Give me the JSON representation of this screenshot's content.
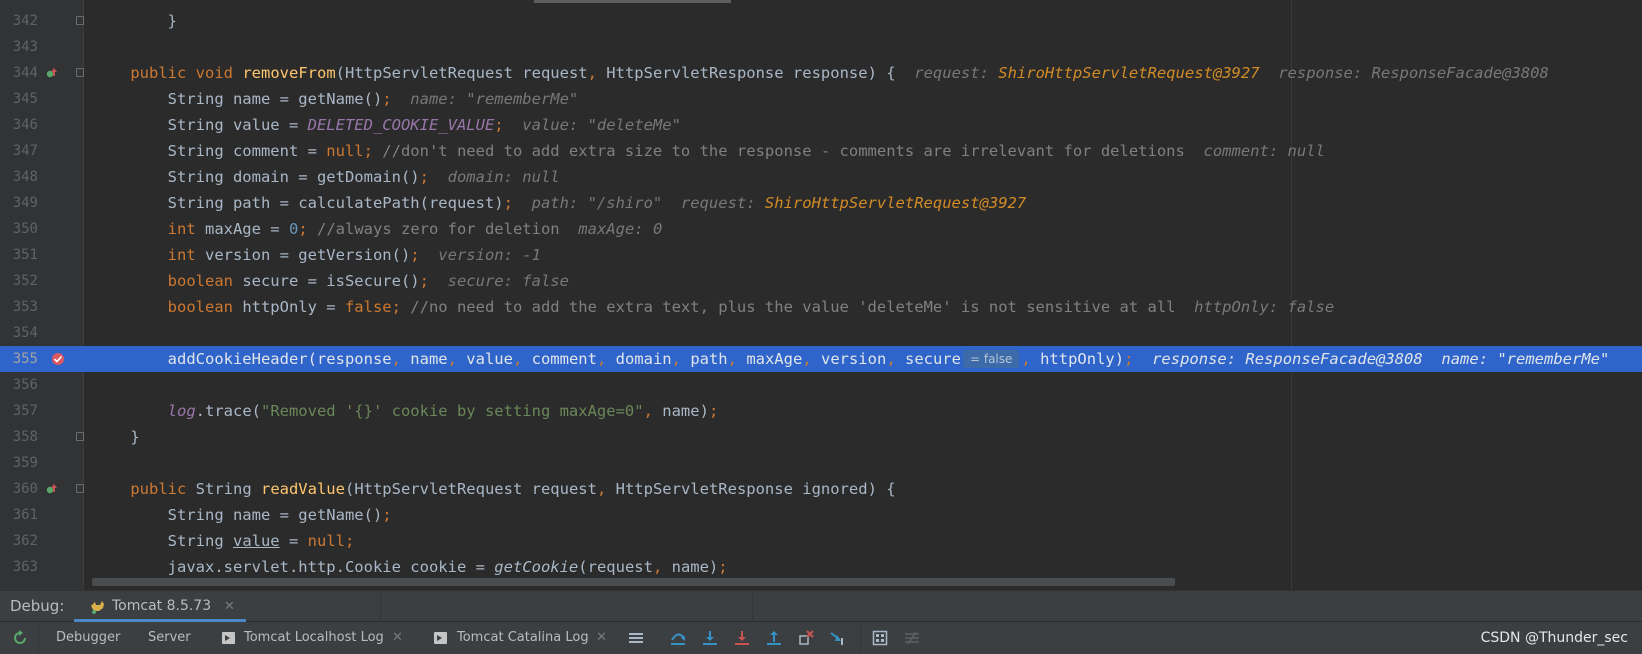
{
  "editor": {
    "lines": [
      {
        "no": "342",
        "gutter": "",
        "fold": true,
        "current": false,
        "tokens": [
          [
            "",
            "        "
          ],
          [
            "",
            "}"
          ]
        ]
      },
      {
        "no": "343",
        "gutter": "",
        "fold": false,
        "current": false,
        "tokens": []
      },
      {
        "no": "344",
        "gutter": "override",
        "fold": true,
        "current": false,
        "tokens": [
          [
            "",
            "    "
          ],
          [
            "k",
            "public "
          ],
          [
            "k",
            "void "
          ],
          [
            "fn",
            "removeFrom"
          ],
          [
            "",
            "(HttpServletRequest request"
          ],
          [
            "k",
            ", "
          ],
          [
            "",
            "HttpServletResponse response) {  "
          ],
          [
            "hint",
            "request: "
          ],
          [
            "hint-obj",
            "ShiroHttpServletRequest@3927"
          ],
          [
            "hint",
            "  response: ResponseFacade@3808"
          ]
        ]
      },
      {
        "no": "345",
        "gutter": "",
        "fold": false,
        "current": false,
        "tokens": [
          [
            "",
            "        String name = getName()"
          ],
          [
            "k",
            ";  "
          ],
          [
            "hint",
            "name: \"rememberMe\""
          ]
        ]
      },
      {
        "no": "346",
        "gutter": "",
        "fold": false,
        "current": false,
        "tokens": [
          [
            "",
            "        String value = "
          ],
          [
            "cst",
            "DELETED_COOKIE_VALUE"
          ],
          [
            "k",
            ";  "
          ],
          [
            "hint",
            "value: \"deleteMe\""
          ]
        ]
      },
      {
        "no": "347",
        "gutter": "",
        "fold": false,
        "current": false,
        "tokens": [
          [
            "",
            "        String comment = "
          ],
          [
            "k",
            "null; "
          ],
          [
            "cm",
            "//don't need to add extra size to the response - comments are irrelevant for deletions  "
          ],
          [
            "hint",
            "comment: null"
          ]
        ]
      },
      {
        "no": "348",
        "gutter": "",
        "fold": false,
        "current": false,
        "tokens": [
          [
            "",
            "        String domain = getDomain()"
          ],
          [
            "k",
            ";  "
          ],
          [
            "hint",
            "domain: null"
          ]
        ]
      },
      {
        "no": "349",
        "gutter": "",
        "fold": false,
        "current": false,
        "tokens": [
          [
            "",
            "        String path = calculatePath(request)"
          ],
          [
            "k",
            ";  "
          ],
          [
            "hint",
            "path: \"/shiro\"  request: "
          ],
          [
            "hint-obj",
            "ShiroHttpServletRequest@3927"
          ]
        ]
      },
      {
        "no": "350",
        "gutter": "",
        "fold": false,
        "current": false,
        "tokens": [
          [
            "",
            "        "
          ],
          [
            "k",
            "int "
          ],
          [
            "",
            "maxAge = "
          ],
          [
            "num",
            "0"
          ],
          [
            "k",
            "; "
          ],
          [
            "cm",
            "//always zero for deletion  "
          ],
          [
            "hint",
            "maxAge: 0"
          ]
        ]
      },
      {
        "no": "351",
        "gutter": "",
        "fold": false,
        "current": false,
        "tokens": [
          [
            "",
            "        "
          ],
          [
            "k",
            "int "
          ],
          [
            "",
            "version = getVersion()"
          ],
          [
            "k",
            ";  "
          ],
          [
            "hint",
            "version: -1"
          ]
        ]
      },
      {
        "no": "352",
        "gutter": "",
        "fold": false,
        "current": false,
        "tokens": [
          [
            "",
            "        "
          ],
          [
            "k",
            "boolean "
          ],
          [
            "",
            "secure = isSecure()"
          ],
          [
            "k",
            ";  "
          ],
          [
            "hint",
            "secure: false"
          ]
        ]
      },
      {
        "no": "353",
        "gutter": "",
        "fold": false,
        "current": false,
        "tokens": [
          [
            "",
            "        "
          ],
          [
            "k",
            "boolean "
          ],
          [
            "",
            "httpOnly = "
          ],
          [
            "k",
            "false; "
          ],
          [
            "cm",
            "//no need to add the extra text, plus the value 'deleteMe' is not sensitive at all  "
          ],
          [
            "hint",
            "httpOnly: false"
          ]
        ]
      },
      {
        "no": "354",
        "gutter": "",
        "fold": false,
        "current": false,
        "tokens": []
      },
      {
        "no": "355",
        "gutter": "breakpoint",
        "fold": false,
        "current": true,
        "tokens": [
          [
            "",
            "        addCookieHeader(response"
          ],
          [
            "k",
            ", "
          ],
          [
            "",
            "name"
          ],
          [
            "k",
            ", "
          ],
          [
            "",
            "value"
          ],
          [
            "k",
            ", "
          ],
          [
            "",
            "comment"
          ],
          [
            "k",
            ", "
          ],
          [
            "",
            "domain"
          ],
          [
            "k",
            ", "
          ],
          [
            "",
            "path"
          ],
          [
            "k",
            ", "
          ],
          [
            "",
            "maxAge"
          ],
          [
            "k",
            ", "
          ],
          [
            "",
            "version"
          ],
          [
            "k",
            ", "
          ],
          [
            "",
            "secure"
          ],
          [
            "badge",
            "= false"
          ],
          [
            "k",
            ", "
          ],
          [
            "",
            "httpOnly)"
          ],
          [
            "k",
            ";  "
          ],
          [
            "hint",
            "response: ResponseFacade@3808  name: \"rememberMe\""
          ]
        ]
      },
      {
        "no": "356",
        "gutter": "",
        "fold": false,
        "current": false,
        "tokens": []
      },
      {
        "no": "357",
        "gutter": "",
        "fold": false,
        "current": false,
        "tokens": [
          [
            "",
            "        "
          ],
          [
            "cst",
            "log"
          ],
          [
            "",
            ".trace("
          ],
          [
            "str",
            "\"Removed '{}' cookie by setting maxAge=0\""
          ],
          [
            "k",
            ", "
          ],
          [
            "",
            "name)"
          ],
          [
            "k",
            ";"
          ]
        ]
      },
      {
        "no": "358",
        "gutter": "",
        "fold": true,
        "current": false,
        "tokens": [
          [
            "",
            "    }"
          ]
        ]
      },
      {
        "no": "359",
        "gutter": "",
        "fold": false,
        "current": false,
        "tokens": []
      },
      {
        "no": "360",
        "gutter": "override",
        "fold": true,
        "current": false,
        "tokens": [
          [
            "",
            "    "
          ],
          [
            "k",
            "public "
          ],
          [
            "",
            "String "
          ],
          [
            "fn",
            "readValue"
          ],
          [
            "",
            "(HttpServletRequest request"
          ],
          [
            "k",
            ", "
          ],
          [
            "",
            "HttpServletResponse ignored) {"
          ]
        ]
      },
      {
        "no": "361",
        "gutter": "",
        "fold": false,
        "current": false,
        "tokens": [
          [
            "",
            "        String name = getName()"
          ],
          [
            "k",
            ";"
          ]
        ]
      },
      {
        "no": "362",
        "gutter": "",
        "fold": false,
        "current": false,
        "tokens": [
          [
            "",
            "        String "
          ],
          [
            "ul",
            "value"
          ],
          [
            "",
            ""
          ],
          [
            "",
            ""
          ],
          [
            "",
            ""
          ],
          [
            "",
            ""
          ],
          [
            "",
            ""
          ],
          [
            "",
            ""
          ],
          [
            "",
            ""
          ],
          [
            "",
            ""
          ],
          [
            "",
            ""
          ],
          [
            "",
            ""
          ],
          [
            "",
            ""
          ],
          [
            "",
            ""
          ],
          [
            "",
            ""
          ],
          [
            "",
            ""
          ],
          [
            "",
            ""
          ],
          [
            "",
            ""
          ],
          [
            "",
            ""
          ],
          [
            "",
            ""
          ],
          [
            "",
            ""
          ],
          [
            "",
            ""
          ],
          [
            "",
            ""
          ],
          [
            "",
            ""
          ],
          [
            "",
            ""
          ],
          [
            "",
            ""
          ],
          [
            "",
            ""
          ],
          [
            "",
            ""
          ],
          [
            "",
            ""
          ],
          [
            "",
            ""
          ],
          [
            "",
            ""
          ],
          [
            "",
            ""
          ],
          [
            "",
            ""
          ],
          [
            "",
            ""
          ],
          [
            "",
            ""
          ],
          [
            "",
            ""
          ],
          [
            "",
            ""
          ],
          [
            "",
            ""
          ],
          [
            "",
            ""
          ],
          [
            "",
            ""
          ],
          [
            "",
            ""
          ],
          [
            "",
            ""
          ],
          [
            "",
            ""
          ],
          [
            "",
            ""
          ],
          [
            "",
            ""
          ],
          [
            "",
            ""
          ],
          [
            "",
            ""
          ],
          [
            "",
            ""
          ],
          [
            "",
            ""
          ],
          [
            "",
            ""
          ],
          [
            "",
            ""
          ],
          [
            "",
            ""
          ],
          [
            "",
            ""
          ],
          [
            "",
            ""
          ],
          [
            "",
            ""
          ],
          [
            "",
            ""
          ],
          [
            "",
            ""
          ],
          [
            "",
            ""
          ],
          [
            "",
            ""
          ],
          [
            "",
            ""
          ],
          [
            "",
            ""
          ],
          [
            "",
            ""
          ],
          [
            "",
            ""
          ],
          [
            "",
            ""
          ],
          [
            "",
            ""
          ],
          [
            "",
            ""
          ],
          [
            "",
            ""
          ],
          [
            "",
            ""
          ],
          [
            "",
            ""
          ],
          [
            "",
            ""
          ],
          [
            "",
            ""
          ],
          [
            "",
            ""
          ],
          [
            "",
            ""
          ],
          [
            "",
            ""
          ],
          [
            "",
            ""
          ],
          [
            "",
            ""
          ],
          [
            "",
            ""
          ],
          [
            "",
            ""
          ],
          [
            "",
            ""
          ],
          [
            "",
            ""
          ],
          [
            "",
            ""
          ],
          [
            "",
            ""
          ],
          [
            "",
            ""
          ],
          [
            "",
            ""
          ],
          [
            "",
            ""
          ],
          [
            "",
            ""
          ],
          [
            "",
            ""
          ],
          [
            "",
            ""
          ],
          [
            "",
            ""
          ],
          [
            "",
            ""
          ],
          [
            "",
            ""
          ],
          [
            "",
            ""
          ],
          [
            "",
            ""
          ],
          [
            "",
            ""
          ],
          [
            "",
            ""
          ],
          [
            "",
            ""
          ],
          [
            "",
            ""
          ],
          [
            "",
            ""
          ],
          [
            "",
            ""
          ],
          [
            "",
            ""
          ],
          [
            "",
            ""
          ],
          [
            "",
            ""
          ],
          [
            "",
            ""
          ],
          [
            "",
            ""
          ],
          [
            "",
            ""
          ],
          [
            "",
            ""
          ],
          [
            "",
            ""
          ],
          [
            "",
            ""
          ],
          [
            "",
            ""
          ],
          [
            "",
            ""
          ],
          [
            "",
            ""
          ],
          [
            "",
            " = "
          ],
          [
            "k",
            "null;"
          ]
        ]
      },
      {
        "no": "363",
        "gutter": "",
        "fold": false,
        "current": false,
        "tokens": [
          [
            "",
            "        javax.servlet.http.Cookie cookie = "
          ],
          [
            "ital",
            "getCookie"
          ],
          [
            "",
            "(request"
          ],
          [
            "k",
            ", "
          ],
          [
            "",
            "name)"
          ],
          [
            "k",
            ";"
          ]
        ]
      }
    ]
  },
  "debug_panel": {
    "label": "Debug:",
    "session_tab": "Tomcat 8.5.73",
    "close_glyph": "✕",
    "tabs": [
      "Debugger",
      "Server",
      "Tomcat Localhost Log",
      "Tomcat Catalina Log"
    ]
  },
  "watermark": "CSDN @Thunder_sec",
  "colors": {
    "editor_bg": "#2b2b2b",
    "current_line": "#2f65ca",
    "keyword": "#cc7832",
    "function": "#ffc66d",
    "hint": "#787878"
  }
}
